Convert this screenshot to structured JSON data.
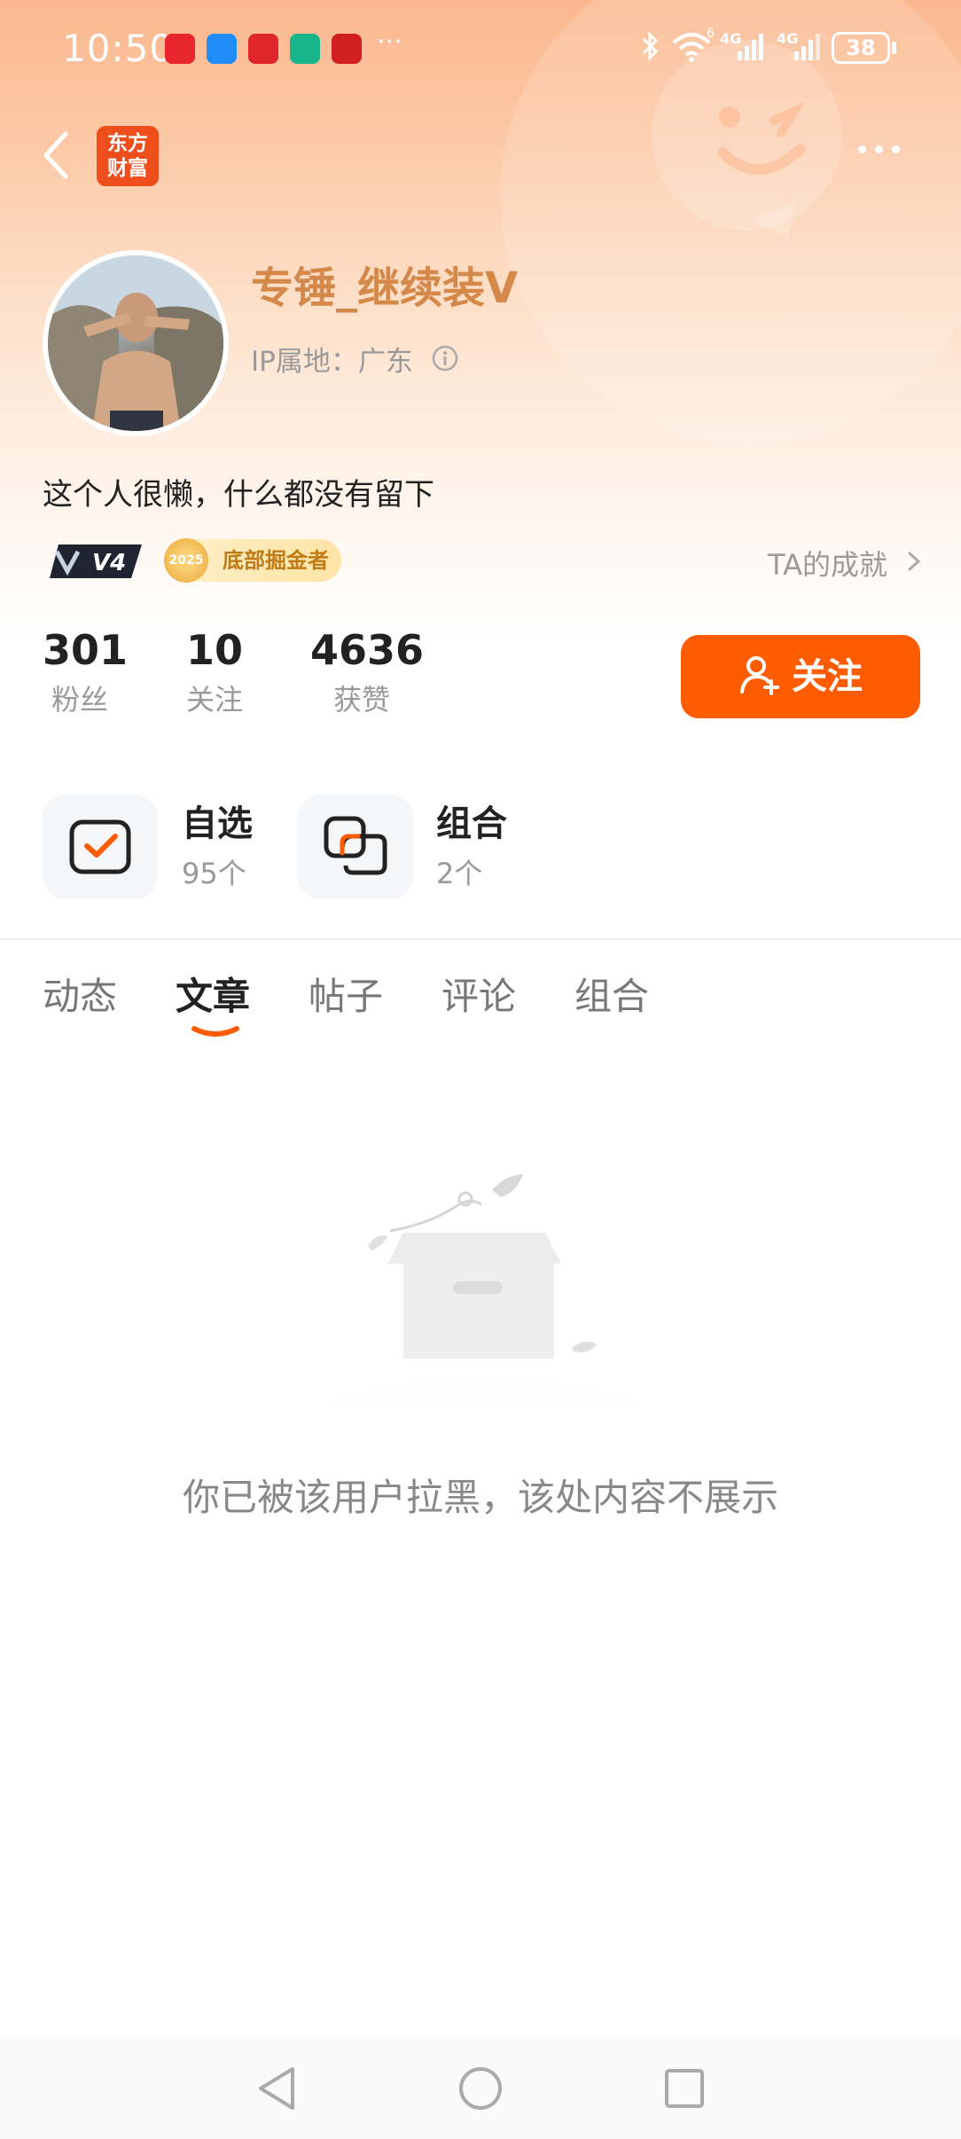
{
  "status_bar": {
    "time": "10:50",
    "more": "···",
    "battery": "38",
    "network_1": "4G",
    "network_2": "4G",
    "wifi_badge": "6"
  },
  "header": {
    "logo_line1": "东方",
    "logo_line2": "财富"
  },
  "profile": {
    "username": "专锤_继续装V",
    "ip_location": "IP属地：广东",
    "bio": "这个人很懒，什么都没有留下",
    "level_badge": "V4",
    "medal_year": "2025",
    "honor_badge": "底部掘金者",
    "achievement_link": "TA的成就"
  },
  "stats": [
    {
      "value": "301",
      "label": "粉丝"
    },
    {
      "value": "10",
      "label": "关注"
    },
    {
      "value": "4636",
      "label": "获赞"
    }
  ],
  "follow_button": "关注",
  "tiles": [
    {
      "title": "自选",
      "subtitle": "95个"
    },
    {
      "title": "组合",
      "subtitle": "2个"
    }
  ],
  "tabs": [
    "动态",
    "文章",
    "帖子",
    "评论",
    "组合"
  ],
  "active_tab": "文章",
  "empty_message": "你已被该用户拉黑，该处内容不展示",
  "colors": {
    "accent": "#ff5b00",
    "username": "#d4894a",
    "logo": "#ee4e1b"
  }
}
